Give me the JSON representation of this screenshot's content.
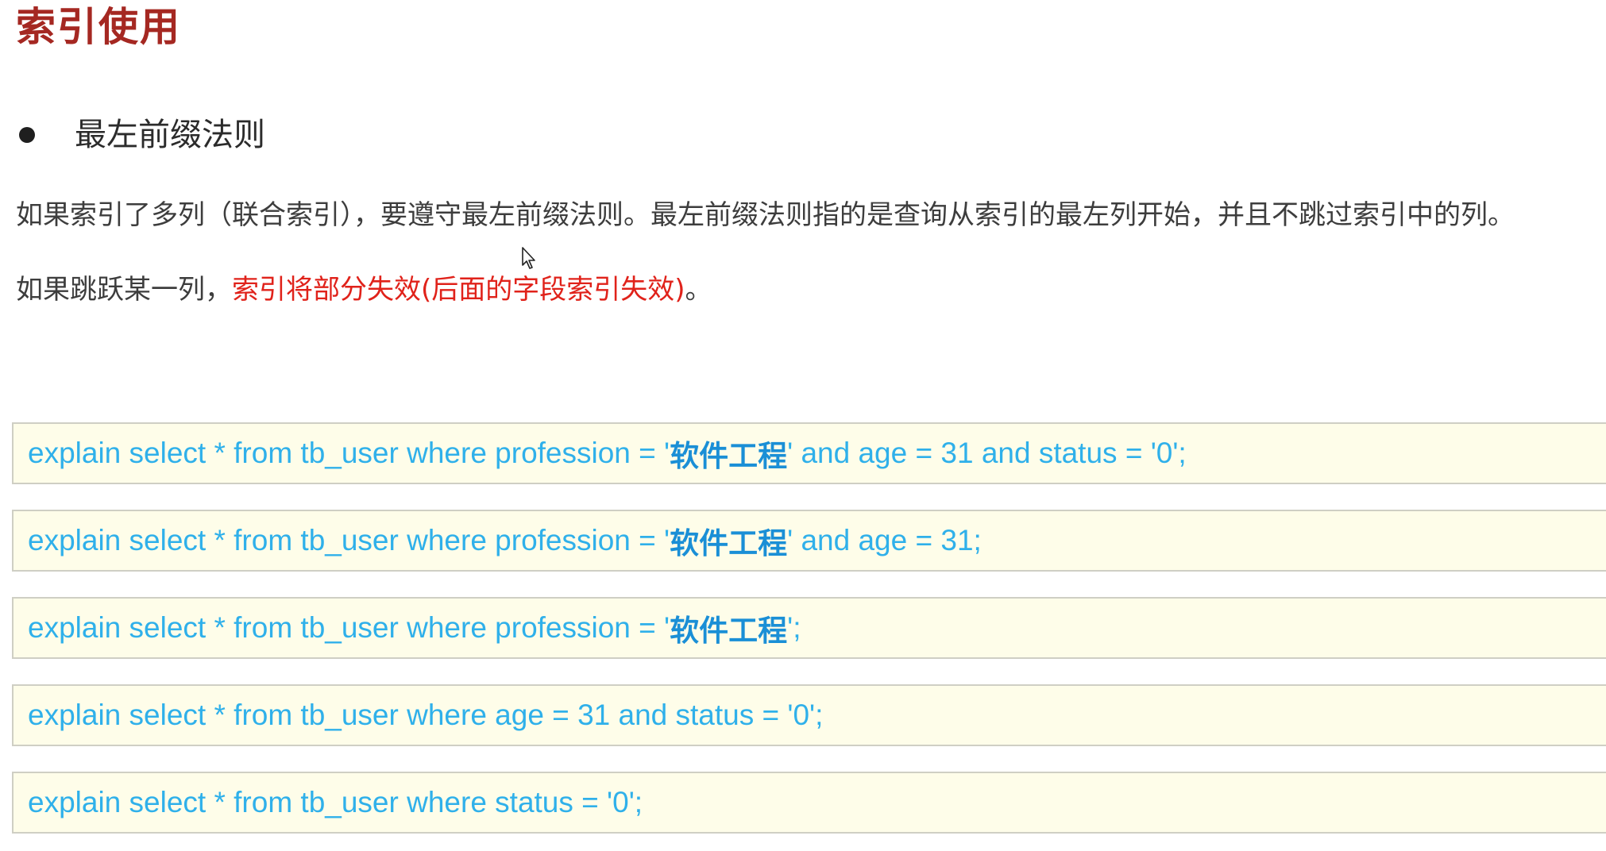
{
  "title": "索引使用",
  "bullet": {
    "text": "最左前缀法则"
  },
  "paragraphs": {
    "p1": "如果索引了多列（联合索引），要遵守最左前缀法则。最左前缀法则指的是查询从索引的最左列开始，并且不跳过索引中的列。",
    "p2_prefix": "如果跳跃某一列，",
    "p2_highlight": "索引将部分失效(后面的字段索引失效)",
    "p2_suffix": "。"
  },
  "code_lines": [
    {
      "prefix": "explain select * from tb_user where profession = '",
      "strong": "软件工程",
      "suffix": "' and age = 31 and status = '0';"
    },
    {
      "prefix": "explain select * from tb_user where profession = '",
      "strong": "软件工程",
      "suffix": "' and age = 31;"
    },
    {
      "prefix": "explain select * from tb_user where profession = '",
      "strong": "软件工程",
      "suffix": "';"
    },
    {
      "prefix": "explain select * from tb_user where age = 31 and status = '0';",
      "strong": "",
      "suffix": ""
    },
    {
      "prefix": "explain select * from tb_user where status = '0';",
      "strong": "",
      "suffix": ""
    }
  ],
  "colors": {
    "title": "#a52822",
    "highlight": "#e0221a",
    "code_text": "#2fb0ea",
    "code_bg": "#fefde9"
  },
  "icons": {
    "bullet": "bullet-dot-icon",
    "cursor": "mouse-pointer-icon"
  }
}
